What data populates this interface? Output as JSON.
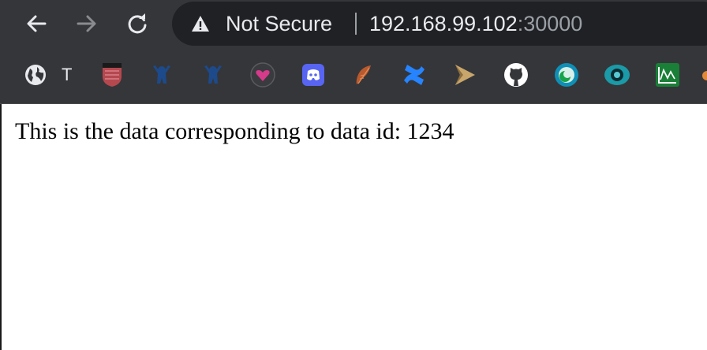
{
  "browser": {
    "security_label": "Not Secure",
    "url_host": "192.168.99.102",
    "url_port": ":30000",
    "bookmarks": [
      {
        "icon": "globe-icon",
        "label": "T"
      },
      {
        "icon": "shield-crest-icon"
      },
      {
        "icon": "jenkins-blue-icon"
      },
      {
        "icon": "jenkins-blue-icon"
      },
      {
        "icon": "heart-badge-icon"
      },
      {
        "icon": "discord-icon"
      },
      {
        "icon": "feather-icon"
      },
      {
        "icon": "confluence-icon"
      },
      {
        "icon": "play-arrow-icon"
      },
      {
        "icon": "github-icon"
      },
      {
        "icon": "ring-circle-icon"
      },
      {
        "icon": "eye-circle-icon"
      },
      {
        "icon": "chart-green-icon"
      }
    ]
  },
  "page": {
    "text": "This is the data corresponding to data id: 1234"
  }
}
